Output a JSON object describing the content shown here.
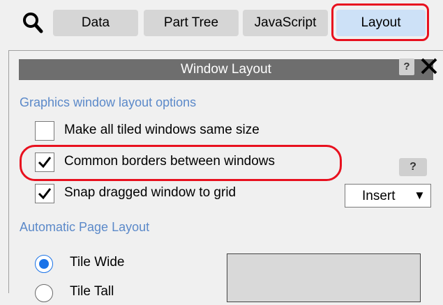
{
  "tabs": [
    {
      "label": "Data",
      "active": false
    },
    {
      "label": "Part Tree",
      "active": false
    },
    {
      "label": "JavaScript",
      "active": false
    },
    {
      "label": "Layout",
      "active": true
    }
  ],
  "panel": {
    "title": "Window Layout",
    "help_small": "?",
    "section_graphics": "Graphics window layout options",
    "options": [
      {
        "label": "Make all tiled windows same size",
        "checked": false
      },
      {
        "label": "Common borders between windows",
        "checked": true
      },
      {
        "label": "Snap dragged window to grid",
        "checked": true
      }
    ],
    "help_label": "?",
    "dropdown_value": "Insert",
    "section_auto": "Automatic Page Layout",
    "radios": [
      {
        "label": "Tile Wide",
        "selected": true
      },
      {
        "label": "Tile Tall",
        "selected": false
      }
    ]
  },
  "colors": {
    "accent_blue": "#1a73e8",
    "highlight_red": "#e8101e",
    "section_blue": "#5b89c9",
    "header_gray": "#6e6e6e"
  },
  "icons": [
    "search-icon",
    "close-icon",
    "checkmark-icon",
    "dropdown-arrow-icon"
  ]
}
